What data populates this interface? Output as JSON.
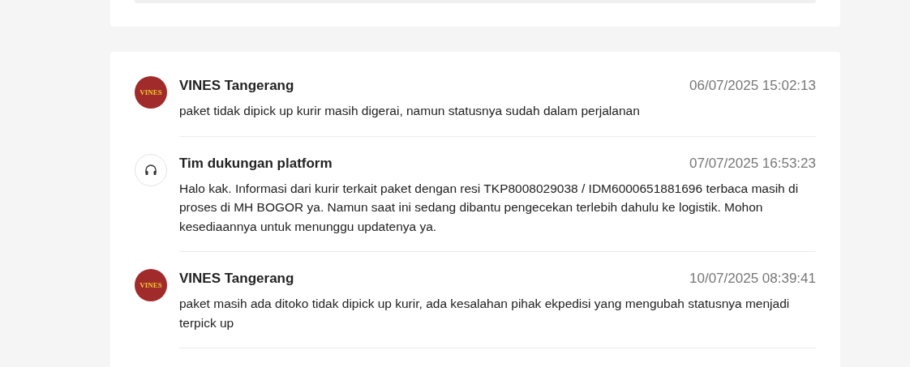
{
  "messages": [
    {
      "sender": "VINES Tangerang",
      "avatar": {
        "kind": "logo",
        "text": "VINES"
      },
      "time": "06/07/2025 15:02:13",
      "text": "paket tidak dipick up kurir masih digerai, namun statusnya sudah dalam perjalanan"
    },
    {
      "sender": "Tim dukungan platform",
      "avatar": {
        "kind": "support"
      },
      "time": "07/07/2025 16:53:23",
      "text": "Halo kak. Informasi dari kurir terkait paket dengan resi TKP8008029038 / IDM6000651881696 terbaca masih di proses di MH BOGOR ya. Namun saat ini sedang dibantu pengecekan terlebih dahulu ke logistik. Mohon kesediaannya untuk menunggu updatenya ya."
    },
    {
      "sender": "VINES Tangerang",
      "avatar": {
        "kind": "logo",
        "text": "VINES"
      },
      "time": "10/07/2025 08:39:41",
      "text": "paket masih ada ditoko tidak dipick up kurir, ada kesalahan pihak ekpedisi yang mengubah statusnya menjadi terpick up"
    }
  ]
}
